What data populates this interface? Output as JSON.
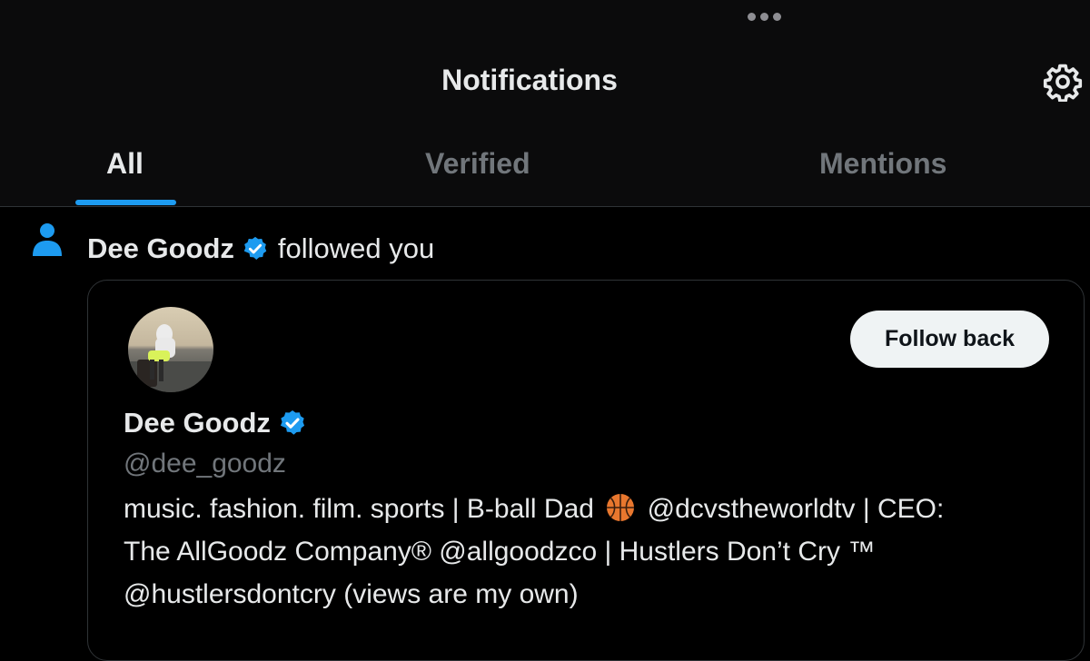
{
  "header": {
    "title": "Notifications",
    "more_icon": "more-dots-icon",
    "settings_icon": "gear-icon"
  },
  "tabs": [
    {
      "label": "All",
      "active": true
    },
    {
      "label": "Verified",
      "active": false
    },
    {
      "label": "Mentions",
      "active": false
    }
  ],
  "notification": {
    "icon": "person-icon",
    "user_name": "Dee Goodz",
    "verified_icon": "verified-badge-icon",
    "action": "followed you"
  },
  "profile_card": {
    "name": "Dee Goodz",
    "handle": "@dee_goodz",
    "follow_button_label": "Follow back",
    "bio_lines": [
      "music. fashion. film. sports | B-ball Dad",
      "@dcvstheworldtv | CEO:",
      "The AllGoodz Company® @allgoodzco | Hustlers Don’t Cry ™",
      "@hustlersdontcry (views are my own)"
    ],
    "bio_emoji_icon": "basketball-icon"
  },
  "colors": {
    "accent": "#1d9bf0",
    "background": "#000000",
    "secondary_text": "#71767b",
    "border": "#2f3336"
  }
}
